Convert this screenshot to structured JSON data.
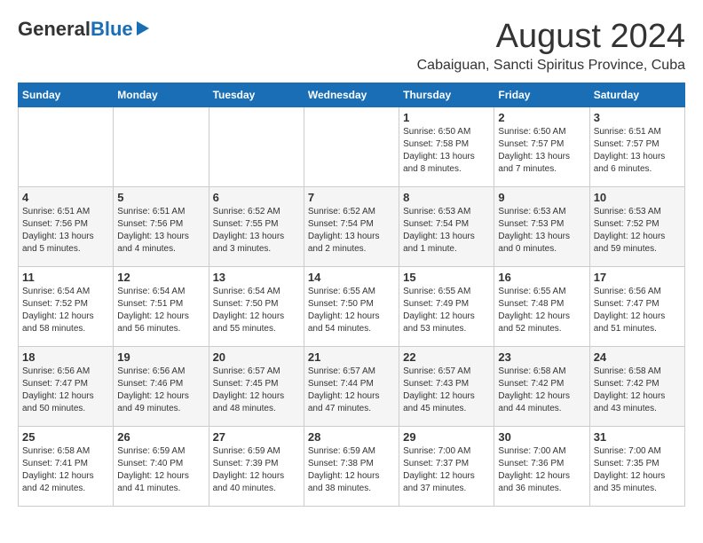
{
  "logo": {
    "general": "General",
    "blue": "Blue"
  },
  "title": {
    "month_year": "August 2024",
    "location": "Cabaiguan, Sancti Spiritus Province, Cuba"
  },
  "headers": [
    "Sunday",
    "Monday",
    "Tuesday",
    "Wednesday",
    "Thursday",
    "Friday",
    "Saturday"
  ],
  "weeks": [
    [
      {
        "day": "",
        "info": ""
      },
      {
        "day": "",
        "info": ""
      },
      {
        "day": "",
        "info": ""
      },
      {
        "day": "",
        "info": ""
      },
      {
        "day": "1",
        "info": "Sunrise: 6:50 AM\nSunset: 7:58 PM\nDaylight: 13 hours\nand 8 minutes."
      },
      {
        "day": "2",
        "info": "Sunrise: 6:50 AM\nSunset: 7:57 PM\nDaylight: 13 hours\nand 7 minutes."
      },
      {
        "day": "3",
        "info": "Sunrise: 6:51 AM\nSunset: 7:57 PM\nDaylight: 13 hours\nand 6 minutes."
      }
    ],
    [
      {
        "day": "4",
        "info": "Sunrise: 6:51 AM\nSunset: 7:56 PM\nDaylight: 13 hours\nand 5 minutes."
      },
      {
        "day": "5",
        "info": "Sunrise: 6:51 AM\nSunset: 7:56 PM\nDaylight: 13 hours\nand 4 minutes."
      },
      {
        "day": "6",
        "info": "Sunrise: 6:52 AM\nSunset: 7:55 PM\nDaylight: 13 hours\nand 3 minutes."
      },
      {
        "day": "7",
        "info": "Sunrise: 6:52 AM\nSunset: 7:54 PM\nDaylight: 13 hours\nand 2 minutes."
      },
      {
        "day": "8",
        "info": "Sunrise: 6:53 AM\nSunset: 7:54 PM\nDaylight: 13 hours\nand 1 minute."
      },
      {
        "day": "9",
        "info": "Sunrise: 6:53 AM\nSunset: 7:53 PM\nDaylight: 13 hours\nand 0 minutes."
      },
      {
        "day": "10",
        "info": "Sunrise: 6:53 AM\nSunset: 7:52 PM\nDaylight: 12 hours\nand 59 minutes."
      }
    ],
    [
      {
        "day": "11",
        "info": "Sunrise: 6:54 AM\nSunset: 7:52 PM\nDaylight: 12 hours\nand 58 minutes."
      },
      {
        "day": "12",
        "info": "Sunrise: 6:54 AM\nSunset: 7:51 PM\nDaylight: 12 hours\nand 56 minutes."
      },
      {
        "day": "13",
        "info": "Sunrise: 6:54 AM\nSunset: 7:50 PM\nDaylight: 12 hours\nand 55 minutes."
      },
      {
        "day": "14",
        "info": "Sunrise: 6:55 AM\nSunset: 7:50 PM\nDaylight: 12 hours\nand 54 minutes."
      },
      {
        "day": "15",
        "info": "Sunrise: 6:55 AM\nSunset: 7:49 PM\nDaylight: 12 hours\nand 53 minutes."
      },
      {
        "day": "16",
        "info": "Sunrise: 6:55 AM\nSunset: 7:48 PM\nDaylight: 12 hours\nand 52 minutes."
      },
      {
        "day": "17",
        "info": "Sunrise: 6:56 AM\nSunset: 7:47 PM\nDaylight: 12 hours\nand 51 minutes."
      }
    ],
    [
      {
        "day": "18",
        "info": "Sunrise: 6:56 AM\nSunset: 7:47 PM\nDaylight: 12 hours\nand 50 minutes."
      },
      {
        "day": "19",
        "info": "Sunrise: 6:56 AM\nSunset: 7:46 PM\nDaylight: 12 hours\nand 49 minutes."
      },
      {
        "day": "20",
        "info": "Sunrise: 6:57 AM\nSunset: 7:45 PM\nDaylight: 12 hours\nand 48 minutes."
      },
      {
        "day": "21",
        "info": "Sunrise: 6:57 AM\nSunset: 7:44 PM\nDaylight: 12 hours\nand 47 minutes."
      },
      {
        "day": "22",
        "info": "Sunrise: 6:57 AM\nSunset: 7:43 PM\nDaylight: 12 hours\nand 45 minutes."
      },
      {
        "day": "23",
        "info": "Sunrise: 6:58 AM\nSunset: 7:42 PM\nDaylight: 12 hours\nand 44 minutes."
      },
      {
        "day": "24",
        "info": "Sunrise: 6:58 AM\nSunset: 7:42 PM\nDaylight: 12 hours\nand 43 minutes."
      }
    ],
    [
      {
        "day": "25",
        "info": "Sunrise: 6:58 AM\nSunset: 7:41 PM\nDaylight: 12 hours\nand 42 minutes."
      },
      {
        "day": "26",
        "info": "Sunrise: 6:59 AM\nSunset: 7:40 PM\nDaylight: 12 hours\nand 41 minutes."
      },
      {
        "day": "27",
        "info": "Sunrise: 6:59 AM\nSunset: 7:39 PM\nDaylight: 12 hours\nand 40 minutes."
      },
      {
        "day": "28",
        "info": "Sunrise: 6:59 AM\nSunset: 7:38 PM\nDaylight: 12 hours\nand 38 minutes."
      },
      {
        "day": "29",
        "info": "Sunrise: 7:00 AM\nSunset: 7:37 PM\nDaylight: 12 hours\nand 37 minutes."
      },
      {
        "day": "30",
        "info": "Sunrise: 7:00 AM\nSunset: 7:36 PM\nDaylight: 12 hours\nand 36 minutes."
      },
      {
        "day": "31",
        "info": "Sunrise: 7:00 AM\nSunset: 7:35 PM\nDaylight: 12 hours\nand 35 minutes."
      }
    ]
  ]
}
